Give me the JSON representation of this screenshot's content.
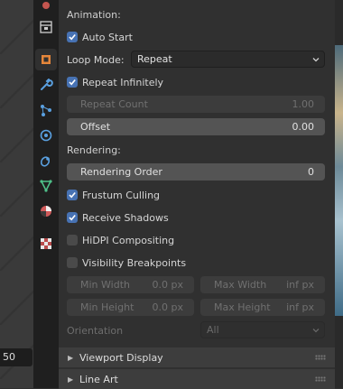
{
  "viewport": {
    "frame_value": "50"
  },
  "tabs": [
    {
      "name": "scene-icon"
    },
    {
      "name": "object-icon",
      "active": true
    },
    {
      "name": "wrench-icon"
    },
    {
      "name": "particles-icon"
    },
    {
      "name": "physics-icon"
    },
    {
      "name": "constraints-icon"
    },
    {
      "name": "data-icon"
    },
    {
      "name": "material-icon"
    },
    {
      "name": "texture-icon"
    }
  ],
  "animation": {
    "header": "Animation:",
    "auto_start": "Auto Start",
    "loop_mode_label": "Loop Mode:",
    "loop_mode_value": "Repeat",
    "repeat_infinitely": "Repeat Infinitely",
    "repeat_count_label": "Repeat Count",
    "repeat_count_value": "1.00",
    "offset_label": "Offset",
    "offset_value": "0.00"
  },
  "rendering": {
    "header": "Rendering:",
    "order_label": "Rendering Order",
    "order_value": "0",
    "frustum_culling": "Frustum Culling",
    "receive_shadows": "Receive Shadows",
    "hidpi": "HiDPI Compositing",
    "visibility_breakpoints": "Visibility Breakpoints",
    "min_width_label": "Min Width",
    "min_width_value": "0.0 px",
    "max_width_label": "Max Width",
    "max_width_value": "inf px",
    "min_height_label": "Min Height",
    "min_height_value": "0.0 px",
    "max_height_label": "Max Height",
    "max_height_value": "inf px",
    "orientation_label": "Orientation",
    "orientation_value": "All"
  },
  "subpanels": {
    "viewport_display": "Viewport Display",
    "line_art": "Line Art"
  },
  "colors": {
    "accent": "#4772b3",
    "object_orange": "#e5863a"
  }
}
